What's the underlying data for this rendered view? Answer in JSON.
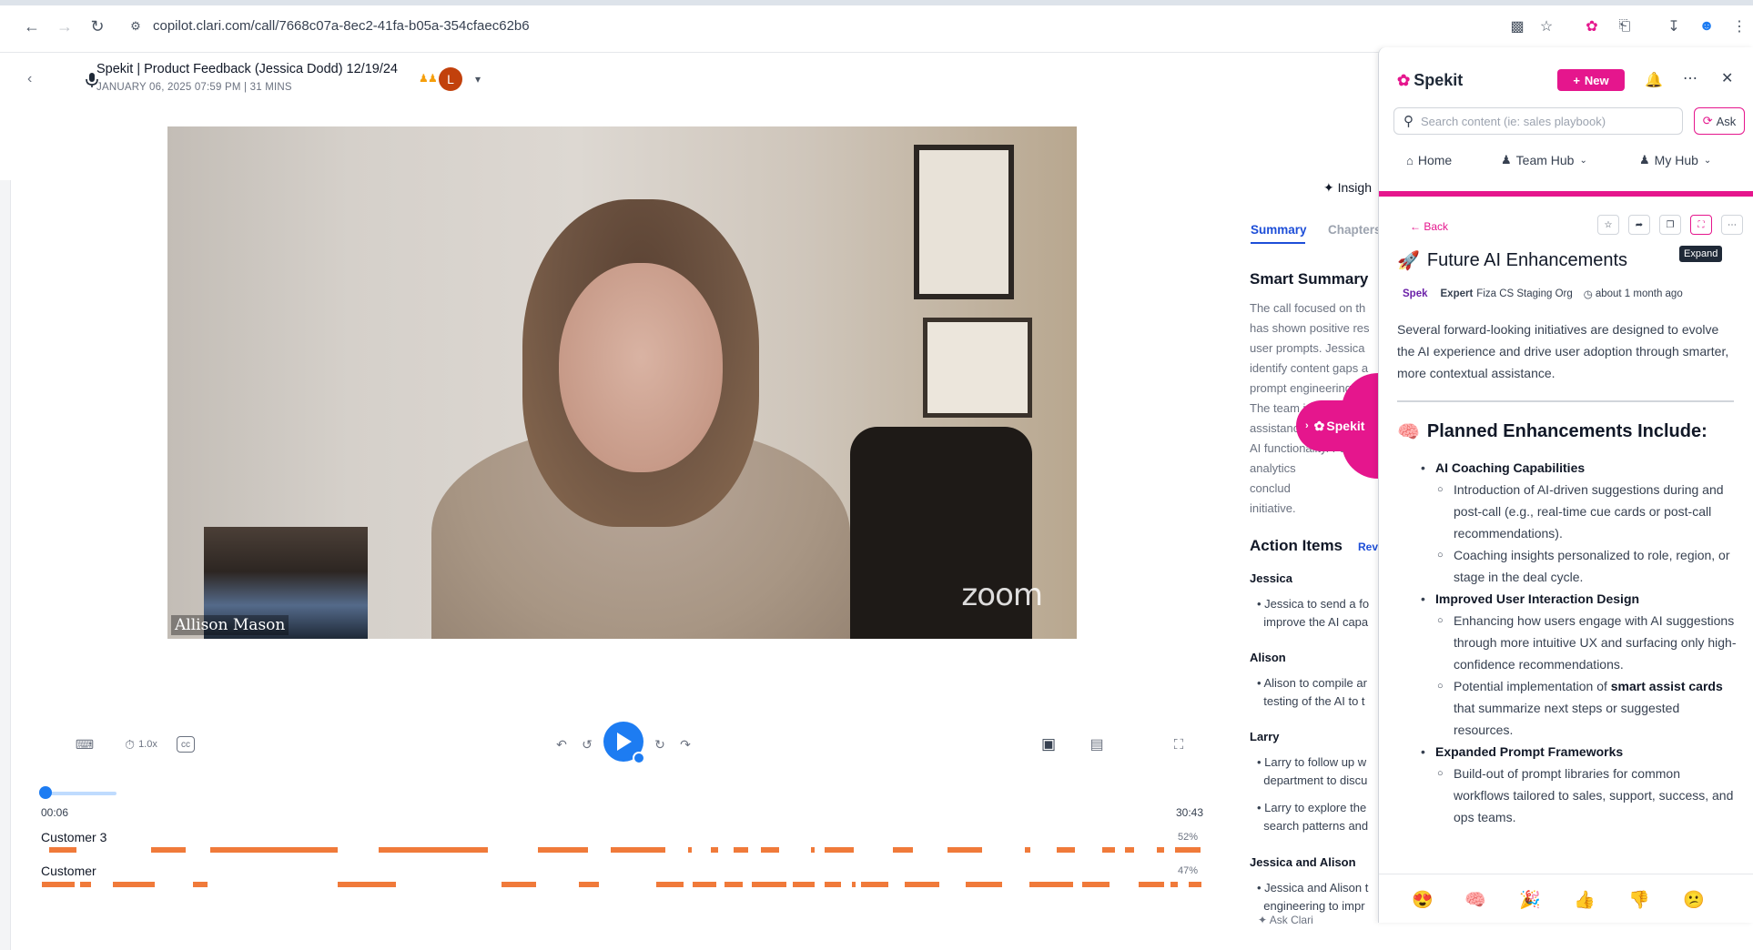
{
  "browser": {
    "url": "copilot.clari.com/call/7668c07a-8ec2-41fa-b05a-354cfaec62b6"
  },
  "call": {
    "title": "Spekit | Product Feedback (Jessica Dodd) 12/19/24",
    "meta": "JANUARY 06, 2025 07:59 PM | 31 MINS",
    "avatar_initial": "L"
  },
  "video": {
    "speaker_name": "Allison Mason",
    "watermark": "zoom"
  },
  "player": {
    "speed": "1.0x",
    "current_time": "00:06",
    "total_time": "30:43",
    "progress_fraction": 0.003
  },
  "tracks": [
    {
      "label": "Customer 3",
      "percent": "52%"
    },
    {
      "label": "Customer",
      "percent": "47%"
    }
  ],
  "summary_panel": {
    "insights_label": "Insigh",
    "tabs": {
      "summary": "Summary",
      "chapters": "Chapters"
    },
    "smart_summary_title": "Smart Summary",
    "summary_lines": [
      "The call focused on th",
      "has shown positive res",
      "user prompts. Jessica",
      "identify content gaps a",
      "prompt engineering to",
      "The team is working o",
      "assistance. They also h",
      "AI functionality. Futu",
      "analytics",
      "conclud",
      "initiative."
    ],
    "action_items_title": "Action Items",
    "action_items_link": "Rev",
    "action_items": [
      {
        "owner": "Jessica",
        "items": [
          [
            "Jessica to send a fo",
            "improve the AI capa"
          ]
        ]
      },
      {
        "owner": "Alison",
        "items": [
          [
            "Alison to compile ar",
            "testing of the AI to t"
          ]
        ]
      },
      {
        "owner": "Larry",
        "items": [
          [
            "Larry to follow up w",
            "department to discu"
          ],
          [
            "Larry to explore the",
            "search patterns and"
          ]
        ]
      },
      {
        "owner": "Jessica and Alison",
        "items": [
          [
            "Jessica and Alison t",
            "engineering to impr"
          ]
        ]
      }
    ],
    "ask_clari": "Ask Clari"
  },
  "spekit_float": {
    "label": "Spekit"
  },
  "spekit": {
    "logo": "Spekit",
    "new_button": "New",
    "search_placeholder": "Search content (ie: sales playbook)",
    "ask_button": "Ask",
    "nav": {
      "home": "Home",
      "team_hub": "Team Hub",
      "my_hub": "My Hub"
    },
    "back": "Back",
    "tooltip": "Expand",
    "article": {
      "title": "Future AI Enhancements",
      "emoji": "🚀",
      "type": "Spek",
      "expert_label": "Expert",
      "org": "Fiza CS Staging Org",
      "updated": "about 1 month ago",
      "intro": "Several forward-looking initiatives are designed to evolve the AI experience and drive user adoption through smarter, more contextual assistance.",
      "heading": "Planned Enhancements Include:",
      "heading_emoji": "🧠",
      "sections": [
        {
          "title": "AI Coaching Capabilities",
          "subs": [
            {
              "pre": "Introduction of AI-driven suggestions during and post-call (e.g., real-time cue cards or post-call recommendations).",
              "bold": "",
              "post": ""
            },
            {
              "pre": "Coaching insights personalized to role, region, or stage in the deal cycle.",
              "bold": "",
              "post": ""
            }
          ]
        },
        {
          "title": "Improved User Interaction Design",
          "subs": [
            {
              "pre": "Enhancing how users engage with AI suggestions through more intuitive UX and surfacing only high-confidence recommendations.",
              "bold": "",
              "post": ""
            },
            {
              "pre": "Potential implementation of ",
              "bold": "smart assist cards",
              "post": " that summarize next steps or suggested resources."
            }
          ]
        },
        {
          "title": "Expanded Prompt Frameworks",
          "subs": [
            {
              "pre": "Build-out of prompt libraries for common workflows tailored to sales, support, success, and ops teams.",
              "bold": "",
              "post": ""
            }
          ]
        }
      ]
    },
    "reactions": [
      "😍",
      "🧠",
      "🎉",
      "👍",
      "👎",
      "😕"
    ]
  }
}
